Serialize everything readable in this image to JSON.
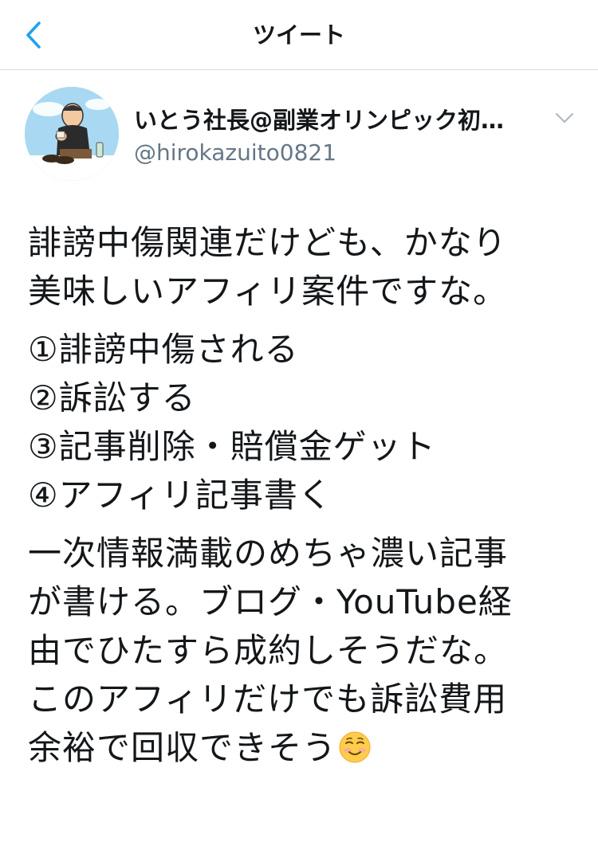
{
  "nav": {
    "title": "ツイート"
  },
  "author": {
    "display_name": "いとう社長@副業オリンピック初…",
    "handle": "@hirokazuito0821"
  },
  "tweet": {
    "paragraph1": [
      "誹謗中傷関連だけども、かなり",
      "美味しいアフィリ案件ですな。"
    ],
    "steps": [
      "①誹謗中傷される",
      "②訴訟する",
      "③記事削除・賠償金ゲット",
      "④アフィリ記事書く"
    ],
    "paragraph3": [
      "一次情報満載のめちゃ濃い記事",
      "が書ける。ブログ・YouTube経",
      "由でひたすら成約しそうだな。",
      "このアフィリだけでも訴訟費用",
      "余裕で回収できそう"
    ],
    "emoji": "smiling-face-emoji"
  },
  "colors": {
    "accent": "#1da1f2",
    "text": "#14171a",
    "secondary": "#657786",
    "divider": "#d8dce0"
  },
  "icons": {
    "back": "chevron-left-icon",
    "caret": "chevron-down-icon"
  }
}
